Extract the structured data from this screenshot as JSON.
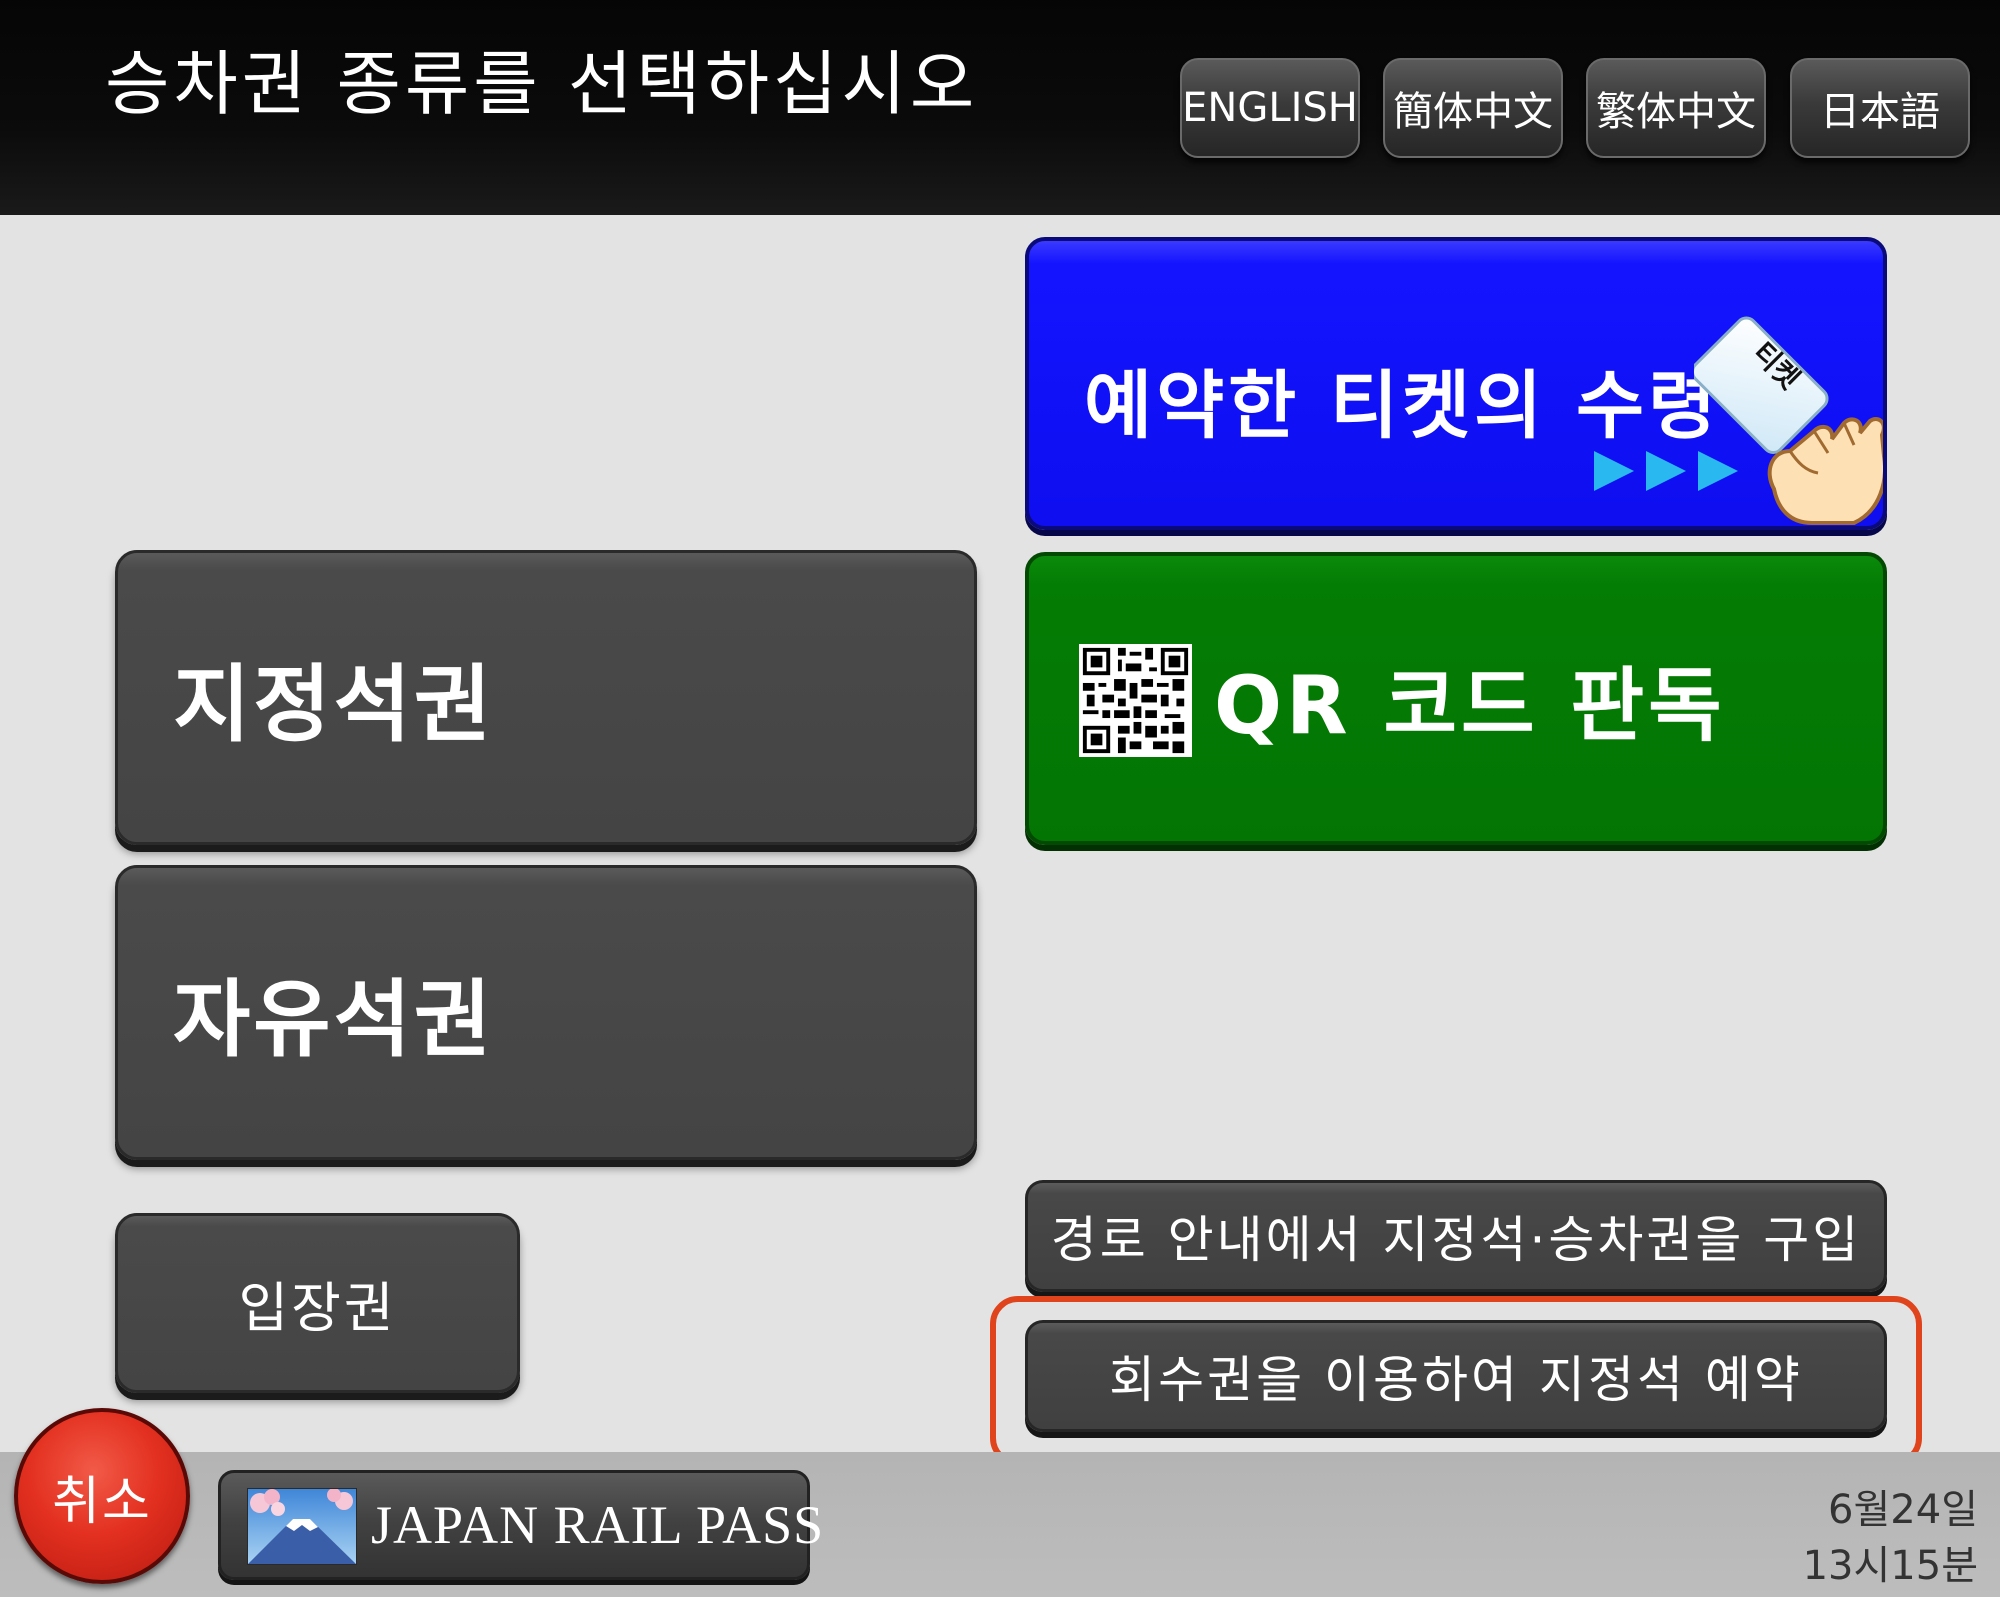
{
  "header": {
    "title": "승차권 종류를 선택하십시오",
    "languages": [
      "ENGLISH",
      "簡体中文",
      "繁体中文",
      "日本語"
    ]
  },
  "main": {
    "reserved_seat": "지정석권",
    "unreserved_seat": "자유석권",
    "platform_ticket": "입장권",
    "receive_reserved": "예약한 티켓의 수령",
    "ticket_card_text": "티켓",
    "qr_read": "QR 코드 판독",
    "route_guide_purchase": "경로 안내에서 지정석·승차권을 구입",
    "coupon_reserve": "회수권을 이용하여 지정석 예약"
  },
  "footer": {
    "cancel": "취소",
    "japan_rail_pass": "JAPAN RAIL PASS",
    "date": "6월24일",
    "time": "13시15분"
  },
  "colors": {
    "blue_button": "#1414ff",
    "green_button": "#047d04",
    "cancel_red": "#e33020",
    "highlight_outline": "#e0441c"
  },
  "icons": [
    "ticket-hand-icon",
    "arrow-right-icon",
    "qr-code-icon",
    "mount-fuji-icon"
  ]
}
